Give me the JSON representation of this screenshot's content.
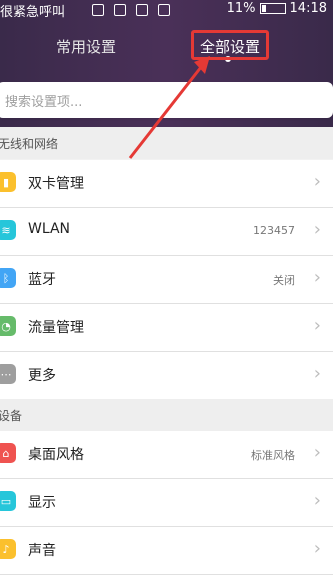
{
  "status_bar": {
    "left_text": "很紧急呼叫",
    "battery": "11%",
    "time": "14:18"
  },
  "tabs": [
    {
      "label": "常用设置"
    },
    {
      "label": "全部设置"
    }
  ],
  "search": {
    "placeholder": "搜索设置项..."
  },
  "sections": [
    {
      "label": "无线和网络"
    },
    {
      "label": "设备"
    }
  ],
  "rows": [
    {
      "title": "双卡管理",
      "value": "",
      "icon": "sim-icon",
      "color": "#fbc02d"
    },
    {
      "title": "WLAN",
      "value": "123457",
      "icon": "wifi-icon",
      "color": "#26c6da"
    },
    {
      "title": "蓝牙",
      "value": "关闭",
      "icon": "bluetooth-icon",
      "color": "#42a5f5"
    },
    {
      "title": "流量管理",
      "value": "",
      "icon": "data-usage-icon",
      "color": "#66bb6a"
    },
    {
      "title": "更多",
      "value": "",
      "icon": "more-icon",
      "color": "#9e9e9e"
    },
    {
      "title": "桌面风格",
      "value": "标准风格",
      "icon": "home-icon",
      "color": "#ef5350"
    },
    {
      "title": "显示",
      "value": "",
      "icon": "display-icon",
      "color": "#26c6da"
    },
    {
      "title": "声音",
      "value": "",
      "icon": "sound-icon",
      "color": "#fbc02d"
    }
  ],
  "colors": {
    "header_bg": "#3f2c50",
    "highlight": "#e53935"
  }
}
